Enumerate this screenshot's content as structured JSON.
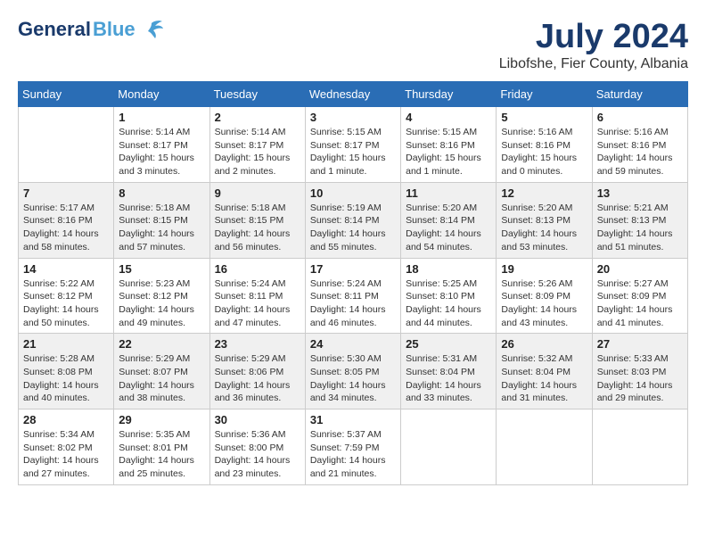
{
  "header": {
    "logo_general": "General",
    "logo_blue": "Blue",
    "month_title": "July 2024",
    "location": "Libofshe, Fier County, Albania"
  },
  "weekdays": [
    "Sunday",
    "Monday",
    "Tuesday",
    "Wednesday",
    "Thursday",
    "Friday",
    "Saturday"
  ],
  "weeks": [
    [
      {
        "day": "",
        "info": ""
      },
      {
        "day": "1",
        "info": "Sunrise: 5:14 AM\nSunset: 8:17 PM\nDaylight: 15 hours\nand 3 minutes."
      },
      {
        "day": "2",
        "info": "Sunrise: 5:14 AM\nSunset: 8:17 PM\nDaylight: 15 hours\nand 2 minutes."
      },
      {
        "day": "3",
        "info": "Sunrise: 5:15 AM\nSunset: 8:17 PM\nDaylight: 15 hours\nand 1 minute."
      },
      {
        "day": "4",
        "info": "Sunrise: 5:15 AM\nSunset: 8:16 PM\nDaylight: 15 hours\nand 1 minute."
      },
      {
        "day": "5",
        "info": "Sunrise: 5:16 AM\nSunset: 8:16 PM\nDaylight: 15 hours\nand 0 minutes."
      },
      {
        "day": "6",
        "info": "Sunrise: 5:16 AM\nSunset: 8:16 PM\nDaylight: 14 hours\nand 59 minutes."
      }
    ],
    [
      {
        "day": "7",
        "info": "Sunrise: 5:17 AM\nSunset: 8:16 PM\nDaylight: 14 hours\nand 58 minutes."
      },
      {
        "day": "8",
        "info": "Sunrise: 5:18 AM\nSunset: 8:15 PM\nDaylight: 14 hours\nand 57 minutes."
      },
      {
        "day": "9",
        "info": "Sunrise: 5:18 AM\nSunset: 8:15 PM\nDaylight: 14 hours\nand 56 minutes."
      },
      {
        "day": "10",
        "info": "Sunrise: 5:19 AM\nSunset: 8:14 PM\nDaylight: 14 hours\nand 55 minutes."
      },
      {
        "day": "11",
        "info": "Sunrise: 5:20 AM\nSunset: 8:14 PM\nDaylight: 14 hours\nand 54 minutes."
      },
      {
        "day": "12",
        "info": "Sunrise: 5:20 AM\nSunset: 8:13 PM\nDaylight: 14 hours\nand 53 minutes."
      },
      {
        "day": "13",
        "info": "Sunrise: 5:21 AM\nSunset: 8:13 PM\nDaylight: 14 hours\nand 51 minutes."
      }
    ],
    [
      {
        "day": "14",
        "info": "Sunrise: 5:22 AM\nSunset: 8:12 PM\nDaylight: 14 hours\nand 50 minutes."
      },
      {
        "day": "15",
        "info": "Sunrise: 5:23 AM\nSunset: 8:12 PM\nDaylight: 14 hours\nand 49 minutes."
      },
      {
        "day": "16",
        "info": "Sunrise: 5:24 AM\nSunset: 8:11 PM\nDaylight: 14 hours\nand 47 minutes."
      },
      {
        "day": "17",
        "info": "Sunrise: 5:24 AM\nSunset: 8:11 PM\nDaylight: 14 hours\nand 46 minutes."
      },
      {
        "day": "18",
        "info": "Sunrise: 5:25 AM\nSunset: 8:10 PM\nDaylight: 14 hours\nand 44 minutes."
      },
      {
        "day": "19",
        "info": "Sunrise: 5:26 AM\nSunset: 8:09 PM\nDaylight: 14 hours\nand 43 minutes."
      },
      {
        "day": "20",
        "info": "Sunrise: 5:27 AM\nSunset: 8:09 PM\nDaylight: 14 hours\nand 41 minutes."
      }
    ],
    [
      {
        "day": "21",
        "info": "Sunrise: 5:28 AM\nSunset: 8:08 PM\nDaylight: 14 hours\nand 40 minutes."
      },
      {
        "day": "22",
        "info": "Sunrise: 5:29 AM\nSunset: 8:07 PM\nDaylight: 14 hours\nand 38 minutes."
      },
      {
        "day": "23",
        "info": "Sunrise: 5:29 AM\nSunset: 8:06 PM\nDaylight: 14 hours\nand 36 minutes."
      },
      {
        "day": "24",
        "info": "Sunrise: 5:30 AM\nSunset: 8:05 PM\nDaylight: 14 hours\nand 34 minutes."
      },
      {
        "day": "25",
        "info": "Sunrise: 5:31 AM\nSunset: 8:04 PM\nDaylight: 14 hours\nand 33 minutes."
      },
      {
        "day": "26",
        "info": "Sunrise: 5:32 AM\nSunset: 8:04 PM\nDaylight: 14 hours\nand 31 minutes."
      },
      {
        "day": "27",
        "info": "Sunrise: 5:33 AM\nSunset: 8:03 PM\nDaylight: 14 hours\nand 29 minutes."
      }
    ],
    [
      {
        "day": "28",
        "info": "Sunrise: 5:34 AM\nSunset: 8:02 PM\nDaylight: 14 hours\nand 27 minutes."
      },
      {
        "day": "29",
        "info": "Sunrise: 5:35 AM\nSunset: 8:01 PM\nDaylight: 14 hours\nand 25 minutes."
      },
      {
        "day": "30",
        "info": "Sunrise: 5:36 AM\nSunset: 8:00 PM\nDaylight: 14 hours\nand 23 minutes."
      },
      {
        "day": "31",
        "info": "Sunrise: 5:37 AM\nSunset: 7:59 PM\nDaylight: 14 hours\nand 21 minutes."
      },
      {
        "day": "",
        "info": ""
      },
      {
        "day": "",
        "info": ""
      },
      {
        "day": "",
        "info": ""
      }
    ]
  ]
}
